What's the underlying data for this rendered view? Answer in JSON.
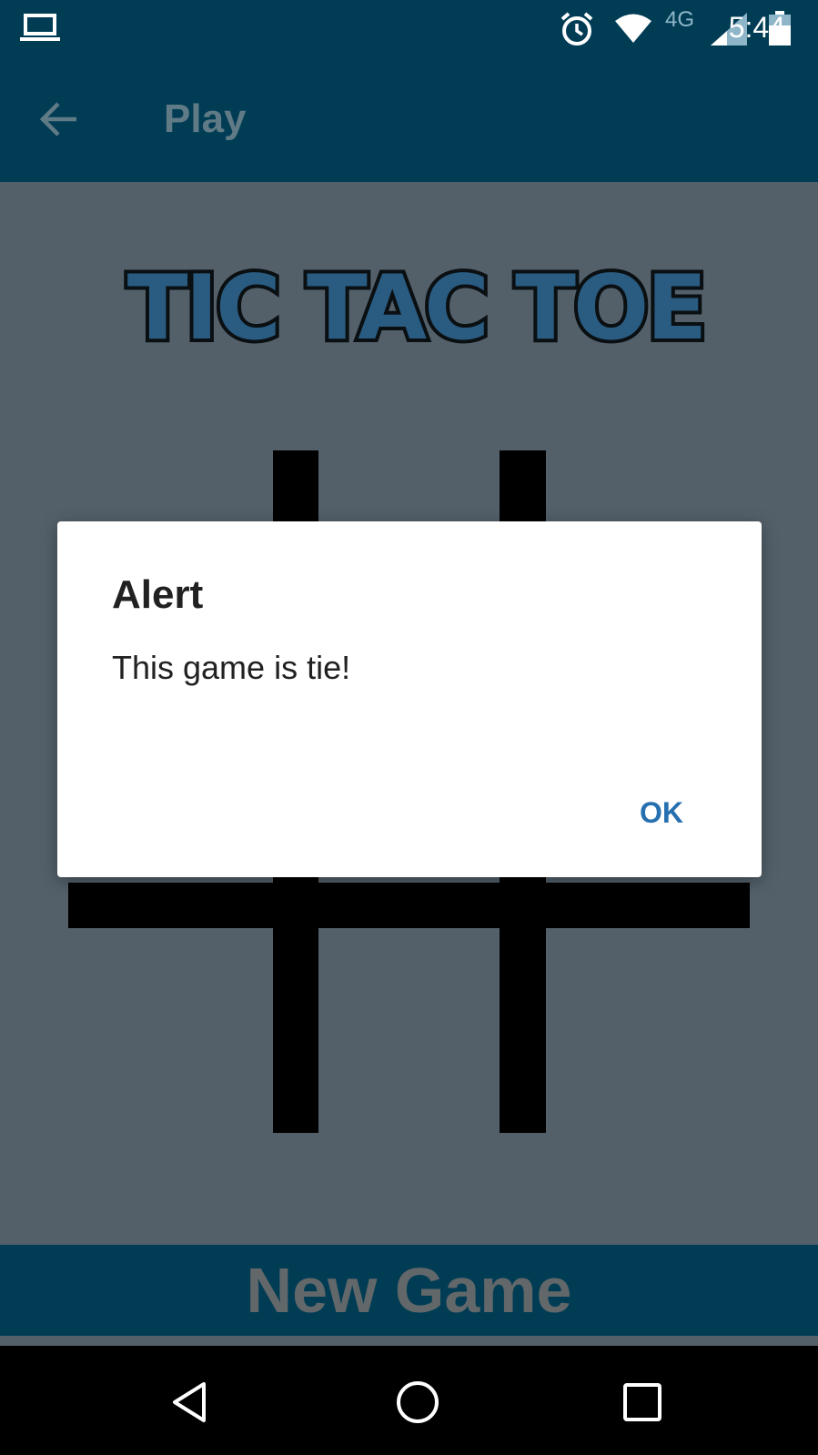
{
  "status_bar": {
    "network": "4G",
    "time": "5:44"
  },
  "app_bar": {
    "title": "Play"
  },
  "game": {
    "logo_text": "TIC TAC TOE",
    "new_game_label": "New Game"
  },
  "dialog": {
    "title": "Alert",
    "message": "This game is tie!",
    "ok_label": "OK"
  },
  "colors": {
    "primary_dark": "#003d55",
    "dim_overlay": "#53606a",
    "dialog_button": "#2670b0"
  },
  "icons": {
    "status": [
      "laptop-icon",
      "alarm-icon",
      "wifi-icon",
      "signal-icon",
      "battery-icon"
    ],
    "navigation": [
      "back-arrow-icon",
      "nav-back-icon",
      "nav-home-icon",
      "nav-recents-icon"
    ]
  }
}
